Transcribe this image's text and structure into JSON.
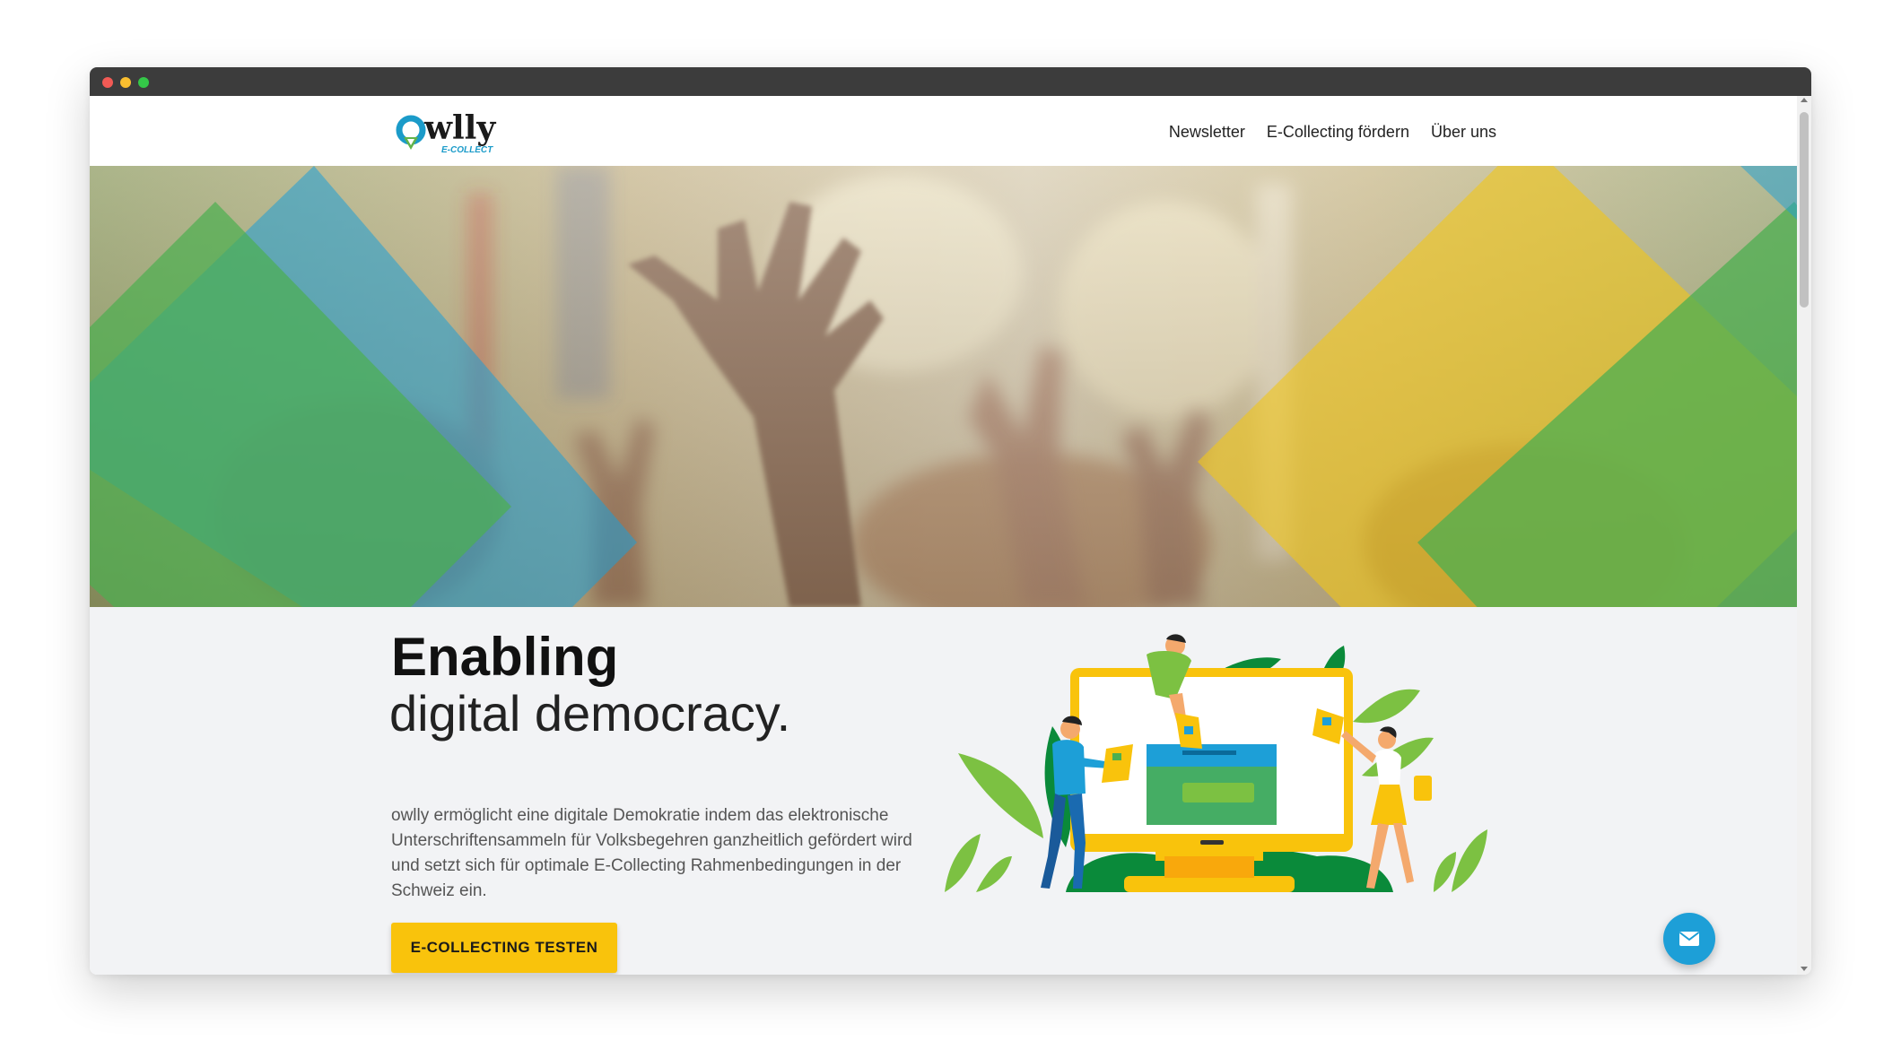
{
  "header": {
    "logo_text": "owlly",
    "logo_subtext": "E-COLLECT",
    "nav": [
      "Newsletter",
      "E-Collecting fördern",
      "Über uns"
    ]
  },
  "hero": {
    "image": "crowd-raised-hands-photo"
  },
  "main": {
    "headline_bold": "Enabling",
    "headline_light": "digital democracy.",
    "description": "owlly ermöglicht eine digitale Demokratie indem das elektronische Unterschriftensammeln für Volksbegehren ganzheitlich gefördert wird und setzt sich für optimale E-Collecting Rahmenbedingungen in der Schweiz ein.",
    "cta_label": "E-COLLECTING TESTEN"
  },
  "chat": {
    "icon": "envelope-icon"
  },
  "colors": {
    "accent_yellow": "#f9c30c",
    "brand_green": "#4caf50",
    "brand_blue": "#1d9fd7",
    "titlebar": "#3c3c3c"
  }
}
